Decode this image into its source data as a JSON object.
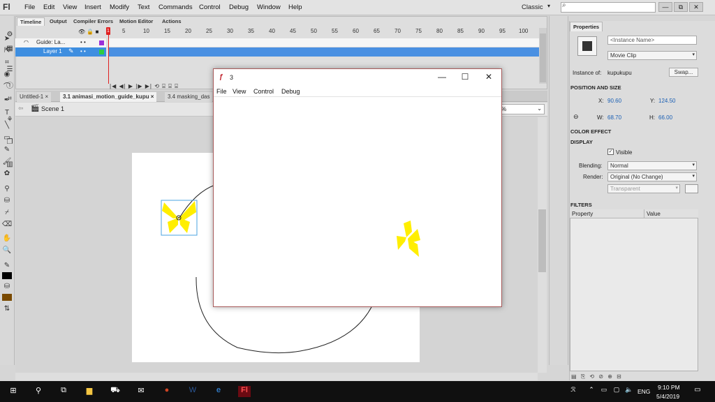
{
  "menubar": {
    "logo": "Fl",
    "items": [
      "File",
      "Edit",
      "View",
      "Insert",
      "Modify",
      "Text",
      "Commands",
      "Control",
      "Debug",
      "Window",
      "Help"
    ],
    "workspace": "Classic",
    "search_glyph": "⌕",
    "window_controls": [
      "—",
      "⧉",
      "✕"
    ]
  },
  "timeline": {
    "tabs": [
      "Timeline",
      "Output",
      "Compiler Errors",
      "Motion Editor",
      "Actions"
    ],
    "header_icons": "👁 🔒 ■",
    "frame_numbers": [
      "5",
      "10",
      "15",
      "20",
      "25",
      "30",
      "35",
      "40",
      "45",
      "50",
      "55",
      "60",
      "65",
      "70",
      "75",
      "80",
      "85",
      "90",
      "95",
      "100"
    ],
    "playhead_label": "1",
    "layers": [
      {
        "name": "Guide: La...",
        "dots": "•  •",
        "color": "#9b30d9"
      },
      {
        "name": "Layer 1",
        "dots": "•  •",
        "color": "#2ecc40"
      }
    ],
    "controls": "|◀ ◀| ▶ |▶ ▶| ⟲ ⌸ ⌸ ⌸"
  },
  "doc_tabs": [
    "Untitled-1 ×",
    "3.1 animasi_motion_guide_kupu ×",
    "3.4 masking_das"
  ],
  "scene": {
    "label": "Scene 1",
    "zoom": "%"
  },
  "player": {
    "title": "3",
    "menu": [
      "File",
      "View",
      "Control",
      "Debug"
    ],
    "controls": [
      "—",
      "☐",
      "✕"
    ]
  },
  "properties": {
    "tab": "Properties",
    "instance_name_placeholder": "<Instance Name>",
    "symbol_type": "Movie Clip",
    "instance_of_label": "Instance of:",
    "instance_of_value": "kupukupu",
    "swap_button": "Swap...",
    "position_size_head": "POSITION AND SIZE",
    "x_label": "X:",
    "x_value": "90.60",
    "y_label": "Y:",
    "y_value": "124.50",
    "w_label": "W:",
    "w_value": "68.70",
    "h_label": "H:",
    "h_value": "66.00",
    "color_effect_head": "COLOR EFFECT",
    "display_head": "DISPLAY",
    "visible_label": "Visible",
    "blending_label": "Blending:",
    "blending_value": "Normal",
    "render_label": "Render:",
    "render_value": "Original (No Change)",
    "transparent_value": "Transparent",
    "filters_head": "FILTERS",
    "filters_col_property": "Property",
    "filters_col_value": "Value"
  },
  "taskbar": {
    "language": "ENG",
    "time": "9:10 PM",
    "date": "5/4/2019"
  },
  "colors": {
    "accent_blue": "#4a90e2",
    "butterfly_yellow": "#ffee00",
    "playhead_red": "#e02020"
  }
}
